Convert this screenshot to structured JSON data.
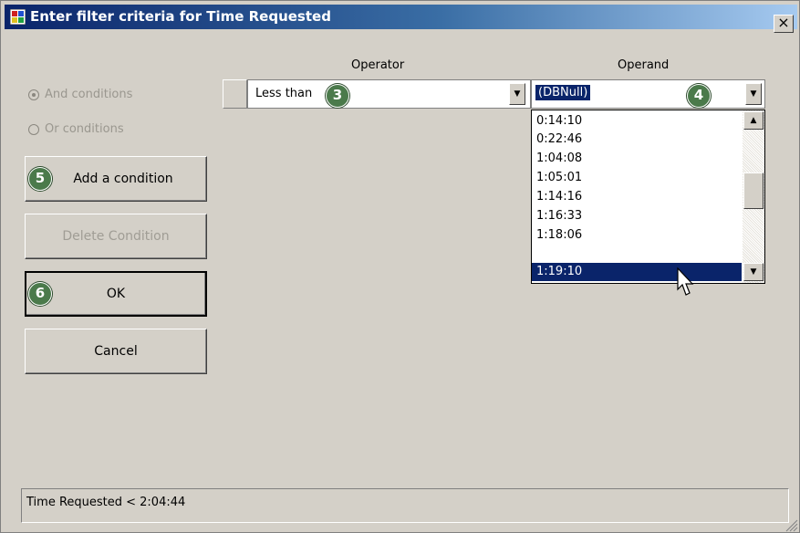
{
  "window": {
    "title": "Enter filter criteria for Time Requested",
    "close_label": "×"
  },
  "conditions": {
    "and_label": "And conditions",
    "or_label": "Or conditions",
    "selected": "and"
  },
  "buttons": {
    "add_condition": "Add a condition",
    "delete_condition": "Delete Condition",
    "ok": "OK",
    "cancel": "Cancel"
  },
  "grid": {
    "operator_header": "Operator",
    "operand_header": "Operand",
    "operator_value": "Less than",
    "operand_value": "(DBNull)"
  },
  "operand_dropdown": {
    "items": [
      "0:14:10",
      "0:22:46",
      "1:04:08",
      "1:05:01",
      "1:14:16",
      "1:16:33",
      "1:18:06",
      "1:19:10"
    ],
    "selected_index": 7
  },
  "callouts": {
    "operator": "3",
    "operand": "4",
    "add": "5",
    "ok": "6"
  },
  "status_text": "Time Requested < 2:04:44",
  "colors": {
    "title_gradient_start": "#0a246a",
    "title_gradient_end": "#a6caf0",
    "selection": "#0a246a",
    "callout_badge": "#4b7a4b",
    "dialog_face": "#d4d0c8"
  }
}
